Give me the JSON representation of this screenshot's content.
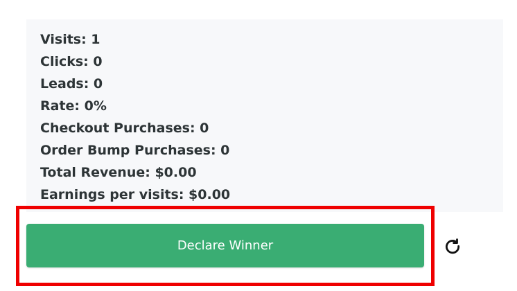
{
  "stats": [
    {
      "text": "Visits: 1"
    },
    {
      "text": "Clicks: 0"
    },
    {
      "text": "Leads: 0"
    },
    {
      "text": "Rate: 0%"
    },
    {
      "text": "Checkout Purchases: 0"
    },
    {
      "text": "Order Bump Purchases: 0"
    },
    {
      "text": "Total Revenue: $0.00"
    },
    {
      "text": "Earnings per visits: $0.00"
    }
  ],
  "actions": {
    "declare_label": "Declare Winner",
    "refresh_icon": "refresh-icon"
  },
  "colors": {
    "panel_background": "#f7f8fa",
    "stat_text": "#2d3436",
    "button_green": "#3aad73",
    "highlight_red": "#ef0000"
  }
}
